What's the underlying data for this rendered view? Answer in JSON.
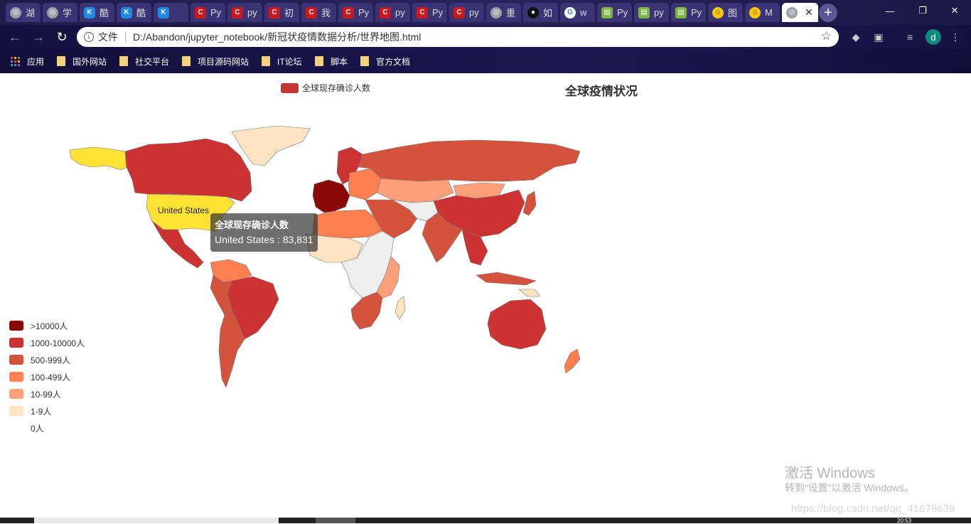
{
  "browser": {
    "tabs": [
      {
        "label": "湖",
        "icon": "globe-icon"
      },
      {
        "label": "学",
        "icon": "globe-icon"
      },
      {
        "label": "酷",
        "icon": "k-app-icon"
      },
      {
        "label": "酷",
        "icon": "k-app-icon"
      },
      {
        "label": "",
        "icon": "k-app-icon"
      },
      {
        "label": "Py",
        "icon": "csdn-icon"
      },
      {
        "label": "py",
        "icon": "csdn-icon"
      },
      {
        "label": "初",
        "icon": "csdn-icon"
      },
      {
        "label": "我",
        "icon": "csdn-icon"
      },
      {
        "label": "Py",
        "icon": "csdn-icon"
      },
      {
        "label": "py",
        "icon": "csdn-icon"
      },
      {
        "label": "Py",
        "icon": "csdn-icon"
      },
      {
        "label": "py",
        "icon": "csdn-icon"
      },
      {
        "label": "重",
        "icon": "globe-icon"
      },
      {
        "label": "如",
        "icon": "black-circle-icon"
      },
      {
        "label": "w",
        "icon": "google-icon"
      },
      {
        "label": "Py",
        "icon": "green-app-icon"
      },
      {
        "label": "py",
        "icon": "green-app-icon"
      },
      {
        "label": "Py",
        "icon": "green-app-icon"
      },
      {
        "label": "图",
        "icon": "yellow-face-icon"
      },
      {
        "label": "M",
        "icon": "yellow-face-icon"
      },
      {
        "label": "",
        "icon": "globe-icon",
        "active": true
      }
    ],
    "address": {
      "scheme_label": "文件",
      "url": "D:/Abandon/jupyter_notebook/新冠状疫情数据分析/世界地图.html"
    },
    "profile_initial": "d",
    "bookmarks": [
      "应用",
      "国外网站",
      "社交平台",
      "项目源码网站",
      "IT论坛",
      "脚本",
      "官方文档"
    ]
  },
  "chart_data": {
    "type": "map",
    "title": "全球疫情状况",
    "series_name": "全球现存确诊人数",
    "series_color": "#c23531",
    "legend_position": "top-center",
    "visual_map": {
      "pieces": [
        {
          "label": ">10000人",
          "color": "#8a0808"
        },
        {
          "label": "1000-10000人",
          "color": "#cd3232"
        },
        {
          "label": "500-999人",
          "color": "#d5523c"
        },
        {
          "label": "100-499人",
          "color": "#ff7f50"
        },
        {
          "label": "10-99人",
          "color": "#ffa07a"
        },
        {
          "label": "1-9人",
          "color": "#ffe4c4"
        },
        {
          "label": "0人",
          "color": "#ffffff"
        }
      ]
    },
    "highlighted": {
      "name": "United States",
      "value": "83,831",
      "color": "#ffe234"
    },
    "tooltip": {
      "title": "全球现存确诊人数",
      "text": "United States : 83,831"
    }
  },
  "watermark": {
    "line1": "激活 Windows",
    "line2": "转到“设置”以激活 Windows。",
    "site": "https://blog.csdn.net/qq_41678639"
  },
  "taskbar": {
    "time": "20:53"
  }
}
